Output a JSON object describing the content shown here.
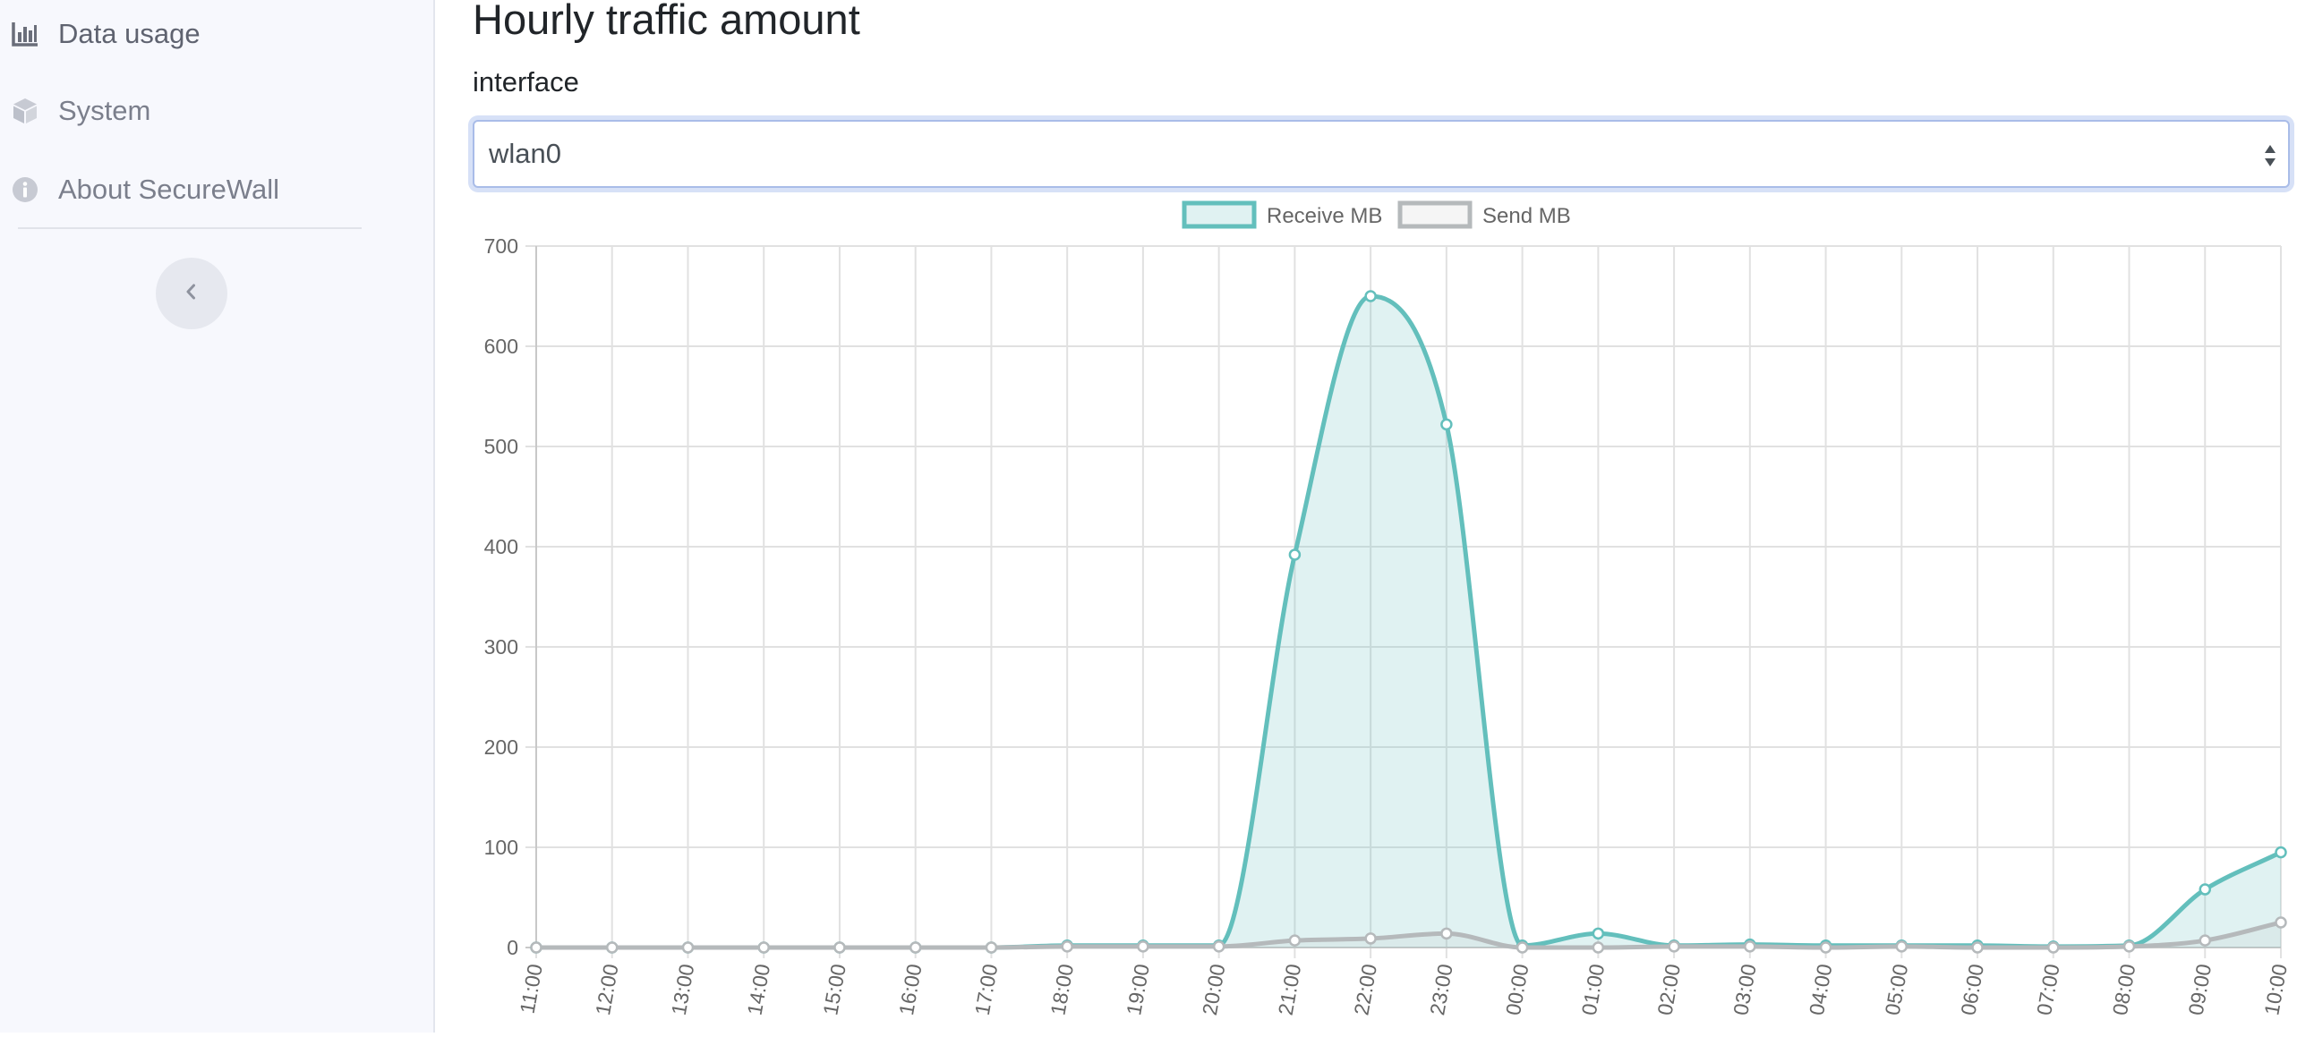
{
  "sidebar": {
    "items": [
      {
        "label": "Data usage",
        "icon": "bar-chart-icon",
        "active": true
      },
      {
        "label": "System",
        "icon": "cube-icon",
        "active": false
      },
      {
        "label": "About SecureWall",
        "icon": "info-circle-icon",
        "active": false
      }
    ],
    "collapse_icon": "chevron-left-icon"
  },
  "main": {
    "title": "Hourly traffic amount",
    "interface_label": "interface",
    "interface_value": "wlan0"
  },
  "chart_data": {
    "type": "line",
    "categories": [
      "11:00",
      "12:00",
      "13:00",
      "14:00",
      "15:00",
      "16:00",
      "17:00",
      "18:00",
      "19:00",
      "20:00",
      "21:00",
      "22:00",
      "23:00",
      "00:00",
      "01:00",
      "02:00",
      "03:00",
      "04:00",
      "05:00",
      "06:00",
      "07:00",
      "08:00",
      "09:00",
      "10:00"
    ],
    "series": [
      {
        "name": "Receive MB",
        "color": "#63bfbc",
        "fill": "rgba(99,191,188,0.2)",
        "values": [
          0,
          0,
          0,
          0,
          0,
          0,
          0,
          2,
          2,
          2,
          392,
          650,
          522,
          2,
          14,
          2,
          3,
          2,
          2,
          2,
          1,
          2,
          58,
          95
        ]
      },
      {
        "name": "Send MB",
        "color": "#b5b9bb",
        "fill": "rgba(190,190,190,0.15)",
        "values": [
          0,
          0,
          0,
          0,
          0,
          0,
          0,
          1,
          1,
          1,
          7,
          9,
          14,
          0,
          0,
          1,
          1,
          0,
          1,
          0,
          0,
          1,
          7,
          25
        ]
      }
    ],
    "ylim": [
      0,
      700
    ],
    "yticks": [
      0,
      100,
      200,
      300,
      400,
      500,
      600,
      700
    ],
    "grid": true,
    "legend": "top-center"
  }
}
